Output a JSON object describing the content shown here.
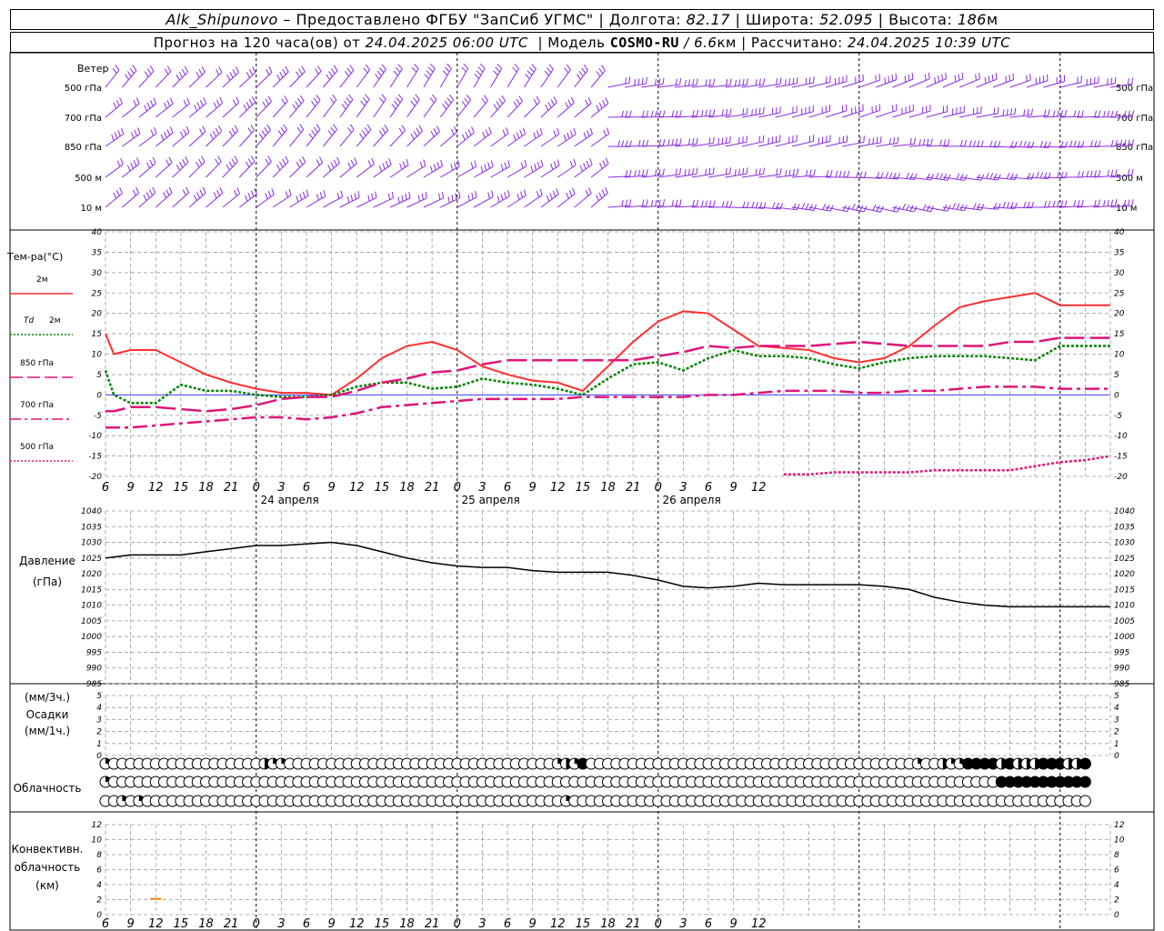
{
  "header": {
    "station": "Alk_Shipunovo",
    "provider": "– Предоставлено ФГБУ \"ЗапСиб УГМС\"",
    "lon_label": "Долгота:",
    "lon": "82.17",
    "lat_label": "Широта:",
    "lat": "52.095",
    "alt_label": "Высота:",
    "alt": "186",
    "alt_unit": "м",
    "forecast_label": "Прогноз на 120 часа(ов) от",
    "forecast_start": "24.04.2025 06:00 UTC",
    "model_label": "Модель",
    "model": "COSMO-RU",
    "model_res": "/ 6.6",
    "model_res_unit": "км",
    "calc_label": "Рассчитано:",
    "calc_time": "24.04.2025 10:39 UTC"
  },
  "wind": {
    "title": "Ветер",
    "levels": [
      "500 гПа",
      "700 гПа",
      "850 гПа",
      "500 м",
      "10 м"
    ],
    "color": "#8a2be2"
  },
  "x_axis": {
    "hour_ticks": [
      "6",
      "9",
      "12",
      "15",
      "18",
      "21",
      "0",
      "3",
      "6",
      "9",
      "12",
      "15",
      "18",
      "21",
      "0",
      "3",
      "6",
      "9",
      "12",
      "15",
      "18",
      "21",
      "0",
      "3",
      "6",
      "9",
      "12"
    ],
    "dates": [
      "24 апреля",
      "25 апреля",
      "26 апреля"
    ]
  },
  "temp_panel": {
    "title": "Тем-ра(°С)",
    "legend": [
      {
        "level": "2м",
        "color": "#ff3030",
        "style": "solid"
      },
      {
        "level": "Td 2м",
        "color": "#008000",
        "style": "dotted"
      },
      {
        "level": "850 гПа",
        "color": "#e0147a",
        "style": "longdash"
      },
      {
        "level": "700 гПа",
        "color": "#e0147a",
        "style": "dashdot"
      },
      {
        "level": "500 гПа",
        "color": "#e0147a",
        "style": "dotted"
      }
    ],
    "y_ticks": [
      "40",
      "35",
      "30",
      "25",
      "20",
      "15",
      "10",
      "5",
      "0",
      "-5",
      "-10",
      "-15",
      "-20"
    ]
  },
  "pressure_panel": {
    "title": "Давление",
    "unit": "(гПа)",
    "y_ticks": [
      "1040",
      "1035",
      "1030",
      "1025",
      "1020",
      "1015",
      "1010",
      "1005",
      "1000",
      "995",
      "990",
      "985"
    ]
  },
  "precip_panel": {
    "unit_3h": "(мм/3ч.)",
    "title": "Осадки",
    "unit_1h": "(мм/1ч.)",
    "y_ticks": [
      "5",
      "4",
      "3",
      "2",
      "1",
      "0"
    ]
  },
  "cloud_panel": {
    "title": "Облачность",
    "rows": [
      "1000000000000000000311000000000000000000000000000000001314000000000000000000000000000000000000000100311444424232444224",
      "1000000000000000000000000000000000000000000000000000000000000000000000000000000000000000000000000000000000044444444444",
      "0010100000000000000000000000000000000000000000000000000100000000000000000000000000000000000000000000000000000000000000"
    ]
  },
  "convective_panel": {
    "title_line1": "Конвективн.",
    "title_line2": "облачность",
    "unit": "(км)",
    "y_ticks": [
      "12",
      "10",
      "8",
      "6",
      "4",
      "2",
      "0"
    ],
    "bars": [
      {
        "hour": 12,
        "bottom_km": 2,
        "top_km": 2.1,
        "color": "#ff8c00"
      }
    ]
  },
  "chart_data": [
    {
      "type": "line",
      "title": "Тем-ра(°С)",
      "x_unit": "hours since 24.04.2025 06:00 UTC",
      "ylim": [
        -20,
        40
      ],
      "x": [
        0,
        1,
        3,
        6,
        9,
        12,
        15,
        18,
        21,
        24,
        27,
        30,
        33,
        36,
        39,
        42,
        45,
        48,
        51,
        54,
        57,
        60,
        63,
        66,
        69,
        72,
        75,
        78,
        81,
        84,
        87,
        90,
        93,
        96,
        99,
        102,
        105,
        108,
        111,
        114,
        117,
        120
      ],
      "series": [
        {
          "name": "2м",
          "values": [
            15,
            10,
            11,
            11,
            8,
            5,
            3,
            1.5,
            0.5,
            0.5,
            0,
            4,
            9,
            12,
            13,
            11,
            7,
            5,
            3.5,
            3,
            1,
            7,
            13,
            18,
            20.5,
            20,
            16,
            12,
            11.5,
            11,
            9,
            8,
            9,
            12,
            17,
            21.5,
            23,
            24,
            25,
            22,
            22,
            22
          ]
        },
        {
          "name": "Td 2м",
          "values": [
            6,
            0,
            -2,
            -2,
            2.5,
            1,
            1,
            0,
            -0.5,
            -0.5,
            0,
            2,
            3,
            3,
            1.5,
            2,
            4,
            3,
            2.5,
            1.5,
            0,
            4,
            7.5,
            8,
            6,
            9,
            11,
            9.5,
            9.5,
            9,
            7.5,
            6.5,
            8,
            9,
            9.5,
            9.5,
            9.5,
            9,
            8.5,
            12,
            12,
            12
          ]
        },
        {
          "name": "850 гПа",
          "values": [
            -4,
            -4,
            -3,
            -3,
            -3.5,
            -4,
            -3.5,
            -2.5,
            -1,
            -0.5,
            -0.5,
            1,
            3,
            4,
            5.5,
            6,
            7.5,
            8.5,
            8.5,
            8.5,
            8.5,
            8.5,
            8.5,
            9.5,
            10.5,
            12,
            11.5,
            12,
            12,
            12,
            12.5,
            13,
            12.5,
            12,
            12,
            12,
            12,
            13,
            13,
            14,
            14,
            14
          ]
        },
        {
          "name": "700 гПа",
          "values": [
            -8,
            -8,
            -8,
            -7.5,
            -7,
            -6.5,
            -6,
            -5.5,
            -5.5,
            -6,
            -5.5,
            -4.5,
            -3,
            -2.5,
            -2,
            -1.5,
            -1,
            -1,
            -1,
            -1,
            -0.5,
            -0.5,
            -0.5,
            -0.5,
            -0.5,
            0,
            0,
            0.5,
            1,
            1,
            1,
            0.5,
            0.5,
            1,
            1,
            1.5,
            2,
            2,
            2,
            1.5,
            1.5,
            1.5
          ]
        },
        {
          "name": "500 гПа",
          "x": [
            81,
            84,
            87,
            90,
            93,
            96,
            99,
            102,
            105,
            108,
            111,
            114,
            117,
            120
          ],
          "values": [
            -19.5,
            -19.5,
            -19,
            -19,
            -19,
            -19,
            -18.5,
            -18.5,
            -18.5,
            -18.5,
            -17.5,
            -16.5,
            -16,
            -15
          ]
        }
      ]
    },
    {
      "type": "line",
      "title": "Давление",
      "x_unit": "hours since 24.04.2025 06:00 UTC",
      "ylim": [
        985,
        1040
      ],
      "x": [
        0,
        3,
        6,
        9,
        12,
        15,
        18,
        21,
        24,
        27,
        30,
        33,
        36,
        39,
        42,
        45,
        48,
        51,
        54,
        57,
        60,
        63,
        66,
        69,
        72,
        75,
        78,
        81,
        84,
        87,
        90,
        93,
        96,
        99,
        102,
        105,
        108,
        111,
        114,
        117,
        120
      ],
      "series": [
        {
          "name": "",
          "values": [
            1025,
            1026,
            1026,
            1026,
            1027,
            1028,
            1029,
            1029,
            1029.5,
            1030,
            1029,
            1027,
            1025,
            1023.5,
            1022.5,
            1022,
            1022,
            1021,
            1020.5,
            1020.5,
            1020.5,
            1019.5,
            1018,
            1016,
            1015.5,
            1016,
            1017,
            1016.5,
            1016.5,
            1016.5,
            1016.5,
            1016,
            1015,
            1012.5,
            1011,
            1010,
            1009.5,
            1009.5,
            1009.5,
            1009.5,
            1009.5
          ]
        }
      ]
    }
  ]
}
